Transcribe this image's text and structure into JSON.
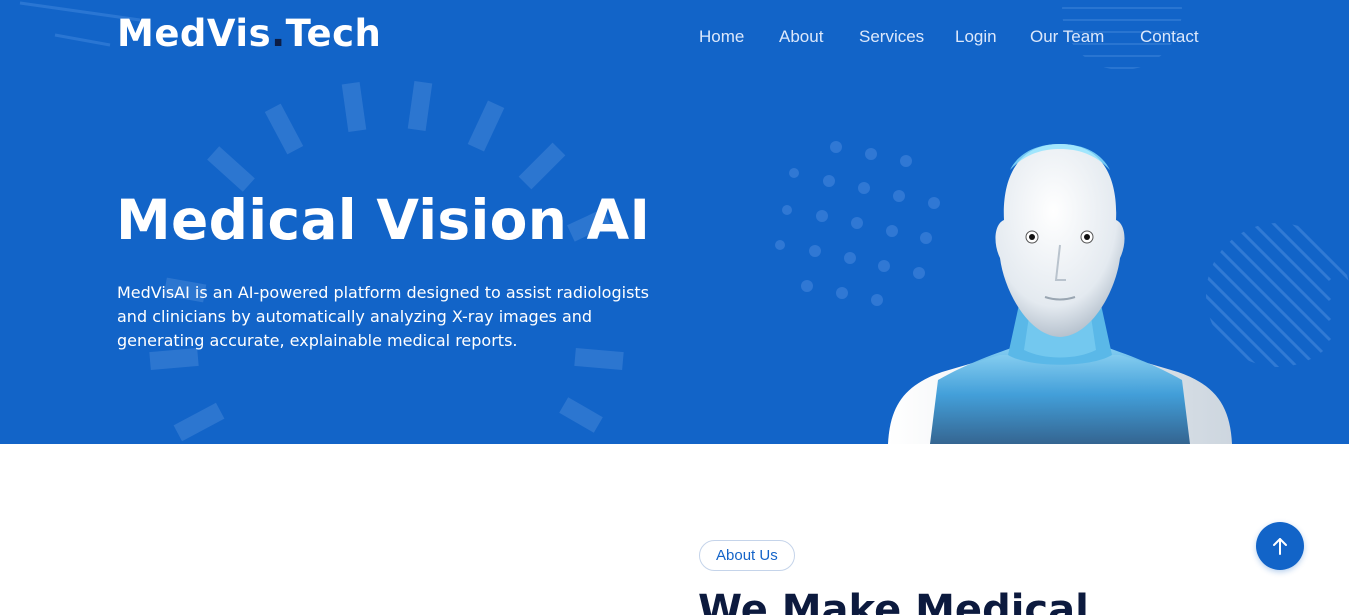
{
  "brand": {
    "name_part1": "MedVis",
    "dot": ".",
    "name_part2": "Tech"
  },
  "nav": {
    "items": [
      {
        "id": "home",
        "label": "Home"
      },
      {
        "id": "about",
        "label": "About"
      },
      {
        "id": "services",
        "label": "Services"
      },
      {
        "id": "login",
        "label": "Login"
      },
      {
        "id": "team",
        "label": "Our Team"
      },
      {
        "id": "contact",
        "label": "Contact"
      }
    ]
  },
  "hero": {
    "title": "Medical Vision AI",
    "description": "MedVisAI is an AI-powered platform designed to assist radiologists and clinicians by automatically analyzing X-ray images and generating accurate, explainable medical reports."
  },
  "about": {
    "badge": "About Us",
    "heading": "We Make Medical"
  },
  "icons": {
    "scroll_top": "arrow-up-icon",
    "robot": "robot-illustration"
  },
  "colors": {
    "primary": "#1264c8",
    "dark": "#0c1a3e",
    "white": "#ffffff"
  }
}
